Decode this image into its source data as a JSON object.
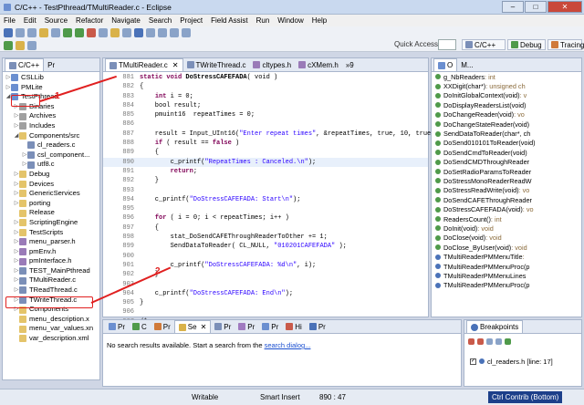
{
  "window": {
    "title": "C/C++ - TestPthread/TMultiReader.c - Eclipse",
    "min": "–",
    "max": "□",
    "close": "✕"
  },
  "menu": [
    "File",
    "Edit",
    "Source",
    "Refactor",
    "Navigate",
    "Search",
    "Project",
    "Field Assist",
    "Run",
    "Window",
    "Help"
  ],
  "toolbar": {
    "quick_access": "Quick Access",
    "perspectives": [
      "C/C++",
      "Debug",
      "Tracing"
    ]
  },
  "left_panel": {
    "tabs": [
      "C/C++",
      "Pr"
    ],
    "tree": [
      {
        "label": "CSLLib",
        "depth": 0,
        "exp": "▷",
        "icon": "p"
      },
      {
        "label": "PMLite",
        "depth": 0,
        "exp": "▷",
        "icon": "p"
      },
      {
        "label": "TestPthread",
        "depth": 0,
        "exp": "◢",
        "icon": "p"
      },
      {
        "label": "Binaries",
        "depth": 1,
        "exp": "▷",
        "icon": "bin"
      },
      {
        "label": "Archives",
        "depth": 1,
        "exp": "▷",
        "icon": "bin"
      },
      {
        "label": "Includes",
        "depth": 1,
        "exp": "▷",
        "icon": "bin"
      },
      {
        "label": "Components/src",
        "depth": 1,
        "exp": "◢",
        "icon": "f"
      },
      {
        "label": "cl_readers.c",
        "depth": 2,
        "exp": "",
        "icon": "c"
      },
      {
        "label": "csl_component...",
        "depth": 2,
        "exp": "▷",
        "icon": "c"
      },
      {
        "label": "utf8.c",
        "depth": 2,
        "exp": "▷",
        "icon": "c"
      },
      {
        "label": "Debug",
        "depth": 1,
        "exp": "▷",
        "icon": "f"
      },
      {
        "label": "Devices",
        "depth": 1,
        "exp": "▷",
        "icon": "f"
      },
      {
        "label": "GenericServices",
        "depth": 1,
        "exp": "▷",
        "icon": "f"
      },
      {
        "label": "porting",
        "depth": 1,
        "exp": "▷",
        "icon": "f"
      },
      {
        "label": "Release",
        "depth": 1,
        "exp": "",
        "icon": "f"
      },
      {
        "label": "ScriptingEngine",
        "depth": 1,
        "exp": "▷",
        "icon": "f"
      },
      {
        "label": "TestScripts",
        "depth": 1,
        "exp": "▷",
        "icon": "f"
      },
      {
        "label": "menu_parser.h",
        "depth": 1,
        "exp": "▷",
        "icon": "h"
      },
      {
        "label": "pmEnv.h",
        "depth": 1,
        "exp": "▷",
        "icon": "h"
      },
      {
        "label": "pmInterface.h",
        "depth": 1,
        "exp": "▷",
        "icon": "h"
      },
      {
        "label": "TEST_MainPthread",
        "depth": 1,
        "exp": "▷",
        "icon": "c"
      },
      {
        "label": "TMultiReader.c",
        "depth": 1,
        "exp": "▷",
        "icon": "c"
      },
      {
        "label": "TReadThread.c",
        "depth": 1,
        "exp": "▷",
        "icon": "c"
      },
      {
        "label": "TWriteThread.c",
        "depth": 1,
        "exp": "▷",
        "icon": "c"
      },
      {
        "label": "Components",
        "depth": 1,
        "exp": "▷",
        "icon": "f"
      },
      {
        "label": "menu_description.x",
        "depth": 1,
        "exp": "",
        "icon": "f"
      },
      {
        "label": "menu_var_values.xn",
        "depth": 1,
        "exp": "",
        "icon": "f"
      },
      {
        "label": "var_description.xml",
        "depth": 1,
        "exp": "",
        "icon": "f"
      }
    ]
  },
  "editor": {
    "tabs": [
      {
        "label": "TMultiReader.c",
        "close": "✕",
        "active": true
      },
      {
        "label": "TWriteThread.c",
        "close": "",
        "active": false
      },
      {
        "label": "cltypes.h",
        "close": "",
        "active": false
      },
      {
        "label": "cXMem.h",
        "close": "",
        "active": false
      },
      {
        "label": "»9",
        "close": "",
        "active": false
      }
    ],
    "lines": [
      {
        "n": "881",
        "segs": [
          [
            "kw",
            "static void "
          ],
          [
            "b",
            "DoStressCAFEFADA"
          ],
          [
            "t",
            "( void )"
          ]
        ]
      },
      {
        "n": "882",
        "segs": [
          [
            "t",
            "{"
          ]
        ]
      },
      {
        "n": "883",
        "segs": [
          [
            "t",
            "    "
          ],
          [
            "kw",
            "int"
          ],
          [
            "t",
            " i = 0;"
          ]
        ]
      },
      {
        "n": "884",
        "segs": [
          [
            "t",
            "    bool result;"
          ]
        ]
      },
      {
        "n": "885",
        "segs": [
          [
            "t",
            "    pmuint16  repeatTimes = 0;"
          ]
        ]
      },
      {
        "n": "886",
        "segs": [
          [
            "t",
            ""
          ]
        ]
      },
      {
        "n": "887",
        "segs": [
          [
            "t",
            "    result = Input_UInt16("
          ],
          [
            "str",
            "\"Enter repeat times\""
          ],
          [
            "t",
            ", &repeatTimes, true, 10, true"
          ]
        ]
      },
      {
        "n": "888",
        "segs": [
          [
            "t",
            "    "
          ],
          [
            "kw",
            "if"
          ],
          [
            "t",
            " ( result == "
          ],
          [
            "kw",
            "false"
          ],
          [
            "t",
            " )"
          ]
        ]
      },
      {
        "n": "889",
        "segs": [
          [
            "t",
            "    {"
          ]
        ]
      },
      {
        "n": "890",
        "segs": [
          [
            "t",
            "        c_printf("
          ],
          [
            "str",
            "\"RepeatTimes : Canceled.\\n\""
          ],
          [
            "t",
            ");"
          ]
        ]
      },
      {
        "n": "891",
        "segs": [
          [
            "t",
            "        "
          ],
          [
            "kw",
            "return"
          ],
          [
            "t",
            ";"
          ]
        ]
      },
      {
        "n": "892",
        "segs": [
          [
            "t",
            "    }"
          ]
        ]
      },
      {
        "n": "893",
        "segs": [
          [
            "t",
            ""
          ]
        ]
      },
      {
        "n": "894",
        "segs": [
          [
            "t",
            "    c_printf("
          ],
          [
            "str",
            "\"DoStressCAFEFADA: Start\\n\""
          ],
          [
            "t",
            ");"
          ]
        ]
      },
      {
        "n": "895",
        "segs": [
          [
            "t",
            ""
          ]
        ]
      },
      {
        "n": "896",
        "segs": [
          [
            "t",
            "    "
          ],
          [
            "kw",
            "for"
          ],
          [
            "t",
            " ( i = 0; i < repeatTimes; i++ )"
          ]
        ]
      },
      {
        "n": "897",
        "segs": [
          [
            "t",
            "    {"
          ]
        ]
      },
      {
        "n": "898",
        "segs": [
          [
            "t",
            "        stat_DoSendCAFEThroughReaderToOther += 1;"
          ]
        ]
      },
      {
        "n": "899",
        "segs": [
          [
            "t",
            "        SendDataToReader( CL_NULL, "
          ],
          [
            "str",
            "\"010201CAFEFADA\""
          ],
          [
            "t",
            " );"
          ]
        ]
      },
      {
        "n": "900",
        "segs": [
          [
            "t",
            ""
          ]
        ]
      },
      {
        "n": "901",
        "segs": [
          [
            "t",
            "        c_printf("
          ],
          [
            "str",
            "\"DoStressCAFEFADA: %d\\n\""
          ],
          [
            "t",
            ", i);"
          ]
        ]
      },
      {
        "n": "902",
        "segs": [
          [
            "t",
            "    }"
          ]
        ]
      },
      {
        "n": "903",
        "segs": [
          [
            "t",
            ""
          ]
        ]
      },
      {
        "n": "904",
        "segs": [
          [
            "t",
            "    c_printf("
          ],
          [
            "str",
            "\"DoStressCAFEFADA: End\\n\""
          ],
          [
            "t",
            ");"
          ]
        ]
      },
      {
        "n": "905",
        "segs": [
          [
            "t",
            "}"
          ]
        ]
      },
      {
        "n": "906",
        "segs": [
          [
            "t",
            ""
          ]
        ]
      },
      {
        "n": "907",
        "segs": [
          [
            "t",
            "/*..."
          ]
        ]
      },
      {
        "n": "908",
        "segs": [
          [
            "t",
            ""
          ]
        ]
      },
      {
        "n": "9089",
        "segs": [
          [
            "kw",
            "static int "
          ],
          [
            "t",
            "ReadersCount()"
          ]
        ]
      }
    ]
  },
  "outline": {
    "tabs": [
      "O",
      "M..."
    ],
    "items": [
      {
        "name": "g_NbReaders",
        "type": " : int",
        "color": "#4f9a4a"
      },
      {
        "name": "XXDigit(char*)",
        "type": " : unsigned ch",
        "color": "#4f9a4a"
      },
      {
        "name": "DoInitGlobalContext(void)",
        "type": " : v",
        "color": "#4f9a4a"
      },
      {
        "name": "DoDisplayReadersList(void)",
        "type": "",
        "color": "#4f9a4a"
      },
      {
        "name": "DoChangeReader(void)",
        "type": " : vo",
        "color": "#4f9a4a"
      },
      {
        "name": "DoChangeStateReader(void)",
        "type": "",
        "color": "#4f9a4a"
      },
      {
        "name": "SendDataToReader(char*, ch",
        "type": "",
        "color": "#4f9a4a"
      },
      {
        "name": "DoSend010101ToReader(void)",
        "type": "",
        "color": "#4f9a4a"
      },
      {
        "name": "DoSendCmdToReader(void)",
        "type": "",
        "color": "#4f9a4a"
      },
      {
        "name": "DoSendCMDThroughReader",
        "type": "",
        "color": "#4f9a4a"
      },
      {
        "name": "DoSetRadioParamsToReader",
        "type": "",
        "color": "#4f9a4a"
      },
      {
        "name": "DoStressMonoReaderReadW",
        "type": "",
        "color": "#4f9a4a"
      },
      {
        "name": "DoStressReadWrite(void)",
        "type": " : vo",
        "color": "#4f9a4a"
      },
      {
        "name": "DoSendCAFEThroughReader",
        "type": "",
        "color": "#4f9a4a"
      },
      {
        "name": "DoStressCAFEFADA(void)",
        "type": " : vo",
        "color": "#4f9a4a"
      },
      {
        "name": "ReadersCount()",
        "type": " : int",
        "color": "#4f9a4a"
      },
      {
        "name": "DoInit(void)",
        "type": " : void",
        "color": "#4f9a4a"
      },
      {
        "name": "DoClose(void)",
        "type": " : void",
        "color": "#4f9a4a"
      },
      {
        "name": "DoClose_ByUser(void)",
        "type": " : void",
        "color": "#4f9a4a"
      },
      {
        "name": "TMultiReaderPMMenuTitle",
        "type": " :",
        "color": "#4a72b8"
      },
      {
        "name": "TMultiReaderPMMenuProc(p",
        "type": "",
        "color": "#4a72b8"
      },
      {
        "name": "TMultiReaderPMMenuLines",
        "type": "",
        "color": "#4a72b8"
      },
      {
        "name": "TMultiReaderPMMenuProc(p",
        "type": "",
        "color": "#4a72b8"
      }
    ]
  },
  "bottom": {
    "tabs": [
      "Pr",
      "C",
      "Pr",
      "Se",
      "Pr",
      "Pr",
      "Pr",
      "Hi",
      "Pr"
    ],
    "message": "No search results available. Start a search from the ",
    "link": "search dialog...",
    "close": "✕"
  },
  "breakpoints": {
    "tab": "Breakpoints",
    "items": [
      "cl_readers.h [line: 17]"
    ]
  },
  "status": {
    "mode": "Writable",
    "insert": "Smart Insert",
    "pos": "890 : 47",
    "contrib": "Ctrl Contrib (Bottom)"
  },
  "annotations": {
    "one": "1",
    "two": "2"
  },
  "colors": {
    "arrow": "#e02020",
    "keyword": "#7f0055",
    "string": "#2a00ff"
  }
}
